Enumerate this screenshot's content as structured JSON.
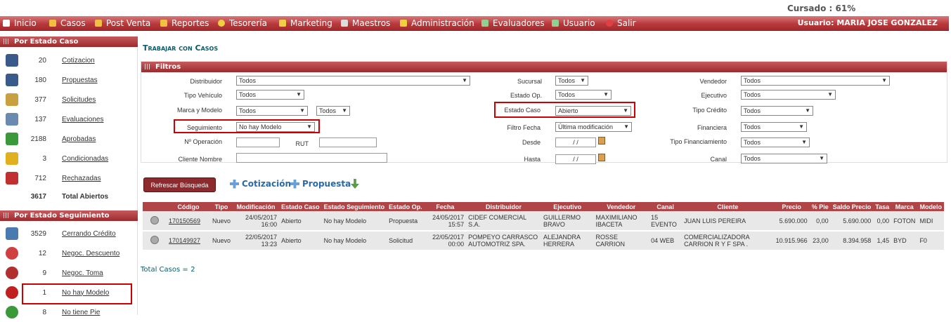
{
  "status_text": "Cursado : 61%",
  "menu": {
    "items": [
      {
        "label": "Inicio",
        "icon": "home-icon"
      },
      {
        "label": "Casos",
        "icon": "folder-icon"
      },
      {
        "label": "Post Venta",
        "icon": "folder-icon"
      },
      {
        "label": "Reportes",
        "icon": "folder-icon"
      },
      {
        "label": "Tesorería",
        "icon": "coin-icon"
      },
      {
        "label": "Marketing",
        "icon": "monitor-icon"
      },
      {
        "label": "Maestros",
        "icon": "database-icon"
      },
      {
        "label": "Administración",
        "icon": "key-icon"
      },
      {
        "label": "Evaluadores",
        "icon": "evaluator-icon"
      },
      {
        "label": "Usuario",
        "icon": "user-icon"
      },
      {
        "label": "Salir",
        "icon": "exit-icon"
      }
    ],
    "user": "Usuario:  MARIA JOSE GONZALEZ"
  },
  "sidebar": {
    "estado_caso_title": "Por Estado Caso",
    "estado_caso": [
      {
        "count": "20",
        "label": "Cotizacion",
        "icon": "calculator-icon",
        "color": "#3a5a8a"
      },
      {
        "count": "180",
        "label": "Propuestas",
        "icon": "calculator-icon",
        "color": "#3a5a8a"
      },
      {
        "count": "377",
        "label": "Solicitudes",
        "icon": "document-pen-icon",
        "color": "#c9a040"
      },
      {
        "count": "137",
        "label": "Evaluaciones",
        "icon": "magnifier-icon",
        "color": "#6a8ab0"
      },
      {
        "count": "2188",
        "label": "Aprobadas",
        "icon": "shield-check-icon",
        "color": "#3a9a3a"
      },
      {
        "count": "3",
        "label": "Condicionadas",
        "icon": "shield-warning-icon",
        "color": "#e0b020"
      },
      {
        "count": "712",
        "label": "Rechazadas",
        "icon": "shield-x-icon",
        "color": "#c03030"
      }
    ],
    "total_count": "3617",
    "total_label": "Total Abiertos",
    "seguimiento_title": "Por Estado Seguimiento",
    "seguimiento": [
      {
        "count": "3529",
        "label": "Cerrando Crédito",
        "icon": "money-icon",
        "color": "#4a7ab0"
      },
      {
        "count": "12",
        "label": "Negoc. Descuento",
        "icon": "percent-icon",
        "color": "#d04040"
      },
      {
        "count": "9",
        "label": "Negoc. Toma",
        "icon": "car-icon",
        "color": "#b03030"
      },
      {
        "count": "1",
        "label": "No hay Modelo",
        "icon": "close-circle-icon",
        "color": "#c02020"
      },
      {
        "count": "8",
        "label": "No tiene Pie",
        "icon": "pie-icon",
        "color": "#3a9a3a"
      }
    ]
  },
  "main": {
    "title": "Trabajar con Casos",
    "filters_title": "Filtros",
    "filters": {
      "distribuidor_label": "Distribuidor",
      "distribuidor": "Todos",
      "sucursal_label": "Sucursal",
      "sucursal": "Todos",
      "vendedor_label": "Vendedor",
      "vendedor": "Todos",
      "tipo_vehiculo_label": "Tipo Vehículo",
      "tipo_vehiculo": "Todos",
      "estado_op_label": "Estado Op.",
      "estado_op": "Todos",
      "ejecutivo_label": "Ejecutivo",
      "ejecutivo": "Todos",
      "marca_modelo_label": "Marca y Modelo",
      "marca": "Todos",
      "modelo": "Todos",
      "estado_caso_label": "Estado Caso",
      "estado_caso": "Abierto",
      "tipo_credito_label": "Tipo Crédito",
      "tipo_credito": "Todos",
      "seguimiento_label": "Seguimiento",
      "seguimiento": "No hay Modelo",
      "filtro_fecha_label": "Filtro Fecha",
      "filtro_fecha": "Última modificación",
      "financiera_label": "Financiera",
      "financiera": "Todos",
      "operacion_label": "Nº Operación",
      "operacion": "",
      "rut_label": "RUT",
      "rut": "",
      "desde_label": "Desde",
      "desde": " / /",
      "tipo_financiamiento_label": "Tipo Financiamiento",
      "tipo_financiamiento": "Todos",
      "cliente_label": "Cliente Nombre",
      "cliente": "",
      "hasta_label": "Hasta",
      "hasta": " / /",
      "canal_label": "Canal",
      "canal": "Todos"
    },
    "refresh_button": "Refrescar Búsqueda",
    "cotizacion_link": "Cotización",
    "propuesta_link": "Propuesta",
    "table": {
      "headers": [
        "Código",
        "Tipo",
        "Modificación",
        "Estado Caso",
        "Estado Seguimiento",
        "Estado Op.",
        "Fecha",
        "Distribuidor",
        "Ejecutivo",
        "Vendedor",
        "Canal",
        "Cliente",
        "Precio",
        "% Pie",
        "Saldo Precio",
        "Tasa",
        "Marca",
        "Modelo"
      ],
      "rows": [
        [
          "170150569",
          "Nuevo",
          "24/05/2017 16:00",
          "Abierto",
          "No hay Modelo",
          "Propuesta",
          "24/05/2017 15:57",
          "CIDEF COMERCIAL S.A.",
          "GUILLERMO BRAVO",
          "MAXIMILIANO IBACETA",
          "15 EVENTO",
          "JUAN LUIS PEREIRA",
          "5.690.000",
          "0,00",
          "5.690.000",
          "0,00",
          "FOTON",
          "MIDI"
        ],
        [
          "170149927",
          "Nuevo",
          "22/05/2017 13:23",
          "Abierto",
          "No hay Modelo",
          "Solicitud",
          "22/05/2017 00:00",
          "POMPEYO CARRASCO AUTOMOTRIZ SPA.",
          "ALEJANDRA HERRERA",
          "ROSSE CARRION",
          "04 WEB",
          "COMERCIALIZADORA CARRION R Y F SPA .",
          "10.915.966",
          "23,00",
          "8.394.958",
          "1,45",
          "BYD",
          "F0"
        ]
      ]
    },
    "total_label": "Total Casos =",
    "total_value": "2"
  }
}
